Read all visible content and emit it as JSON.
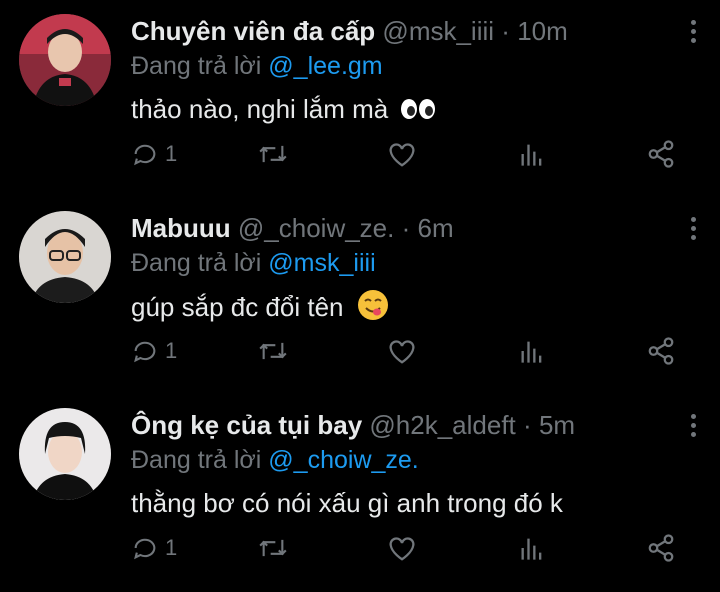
{
  "tweets": [
    {
      "name": "Chuyên viên đa cấp",
      "handle": "@msk_iiii",
      "sep": "·",
      "time": "10m",
      "reply_prefix": "Đang trả lời",
      "reply_to": "@_lee.gm",
      "text": "thảo nào, nghi lắm mà",
      "emoji": "eyes-emoji",
      "reply_count": "1"
    },
    {
      "name": "Mabuuu",
      "handle": "@_choiw_ze.",
      "sep": "·",
      "time": "6m",
      "reply_prefix": "Đang trả lời",
      "reply_to": "@msk_iiii",
      "text": "gúp sắp đc đổi tên",
      "emoji": "yum-face-emoji",
      "reply_count": "1"
    },
    {
      "name": "Ông kẹ của tụi bay",
      "handle": "@h2k_aldeft",
      "sep": "·",
      "time": "5m",
      "reply_prefix": "Đang trả lời",
      "reply_to": "@_choiw_ze.",
      "text": "thằng bơ có nói xấu gì anh trong đó k",
      "emoji": "",
      "reply_count": "1"
    }
  ],
  "colors": {
    "background": "#000000",
    "text": "#e7e9ea",
    "muted": "#71767b",
    "link": "#1d9bf0"
  },
  "icons": [
    "reply-icon",
    "retweet-icon",
    "like-icon",
    "analytics-icon",
    "share-icon",
    "more-icon"
  ]
}
